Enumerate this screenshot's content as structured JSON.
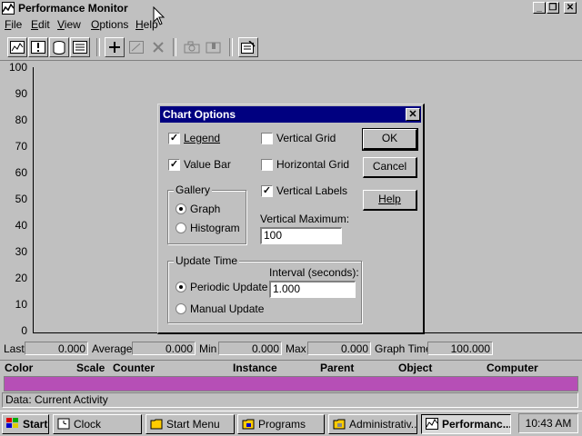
{
  "window": {
    "title": "Performance Monitor",
    "caption_buttons": [
      "minimize",
      "restore",
      "close"
    ]
  },
  "menu": [
    {
      "label": "File",
      "underline": "F"
    },
    {
      "label": "Edit",
      "underline": "E"
    },
    {
      "label": "View",
      "underline": "V"
    },
    {
      "label": "Options",
      "underline": "O"
    },
    {
      "label": "Help",
      "underline": "H"
    }
  ],
  "toolbar": {
    "icons": [
      "chart-view-icon",
      "alert-view-icon",
      "log-view-icon",
      "report-view-icon",
      "add-counter-icon",
      "edit-counter-icon",
      "delete-counter-icon",
      "update-now-icon",
      "bookmark-icon",
      "options-icon"
    ]
  },
  "graph": {
    "y_ticks": [
      "100",
      "90",
      "80",
      "70",
      "60",
      "50",
      "40",
      "30",
      "20",
      "10",
      "0"
    ]
  },
  "value_bar": {
    "last_label": "Last",
    "last_value": "0.000",
    "average_label": "Average",
    "average_value": "0.000",
    "min_label": "Min",
    "min_value": "0.000",
    "max_label": "Max",
    "max_value": "0.000",
    "graph_time_label": "Graph Time",
    "graph_time_value": "100.000"
  },
  "legend_columns": [
    "Color",
    "Scale",
    "Counter",
    "Instance",
    "Parent",
    "Object",
    "Computer"
  ],
  "legend_row_color": "#b64fb6",
  "status": "Data: Current Activity",
  "dialog": {
    "title": "Chart Options",
    "legend_label": "Legend",
    "legend_checked": true,
    "value_bar_label": "Value Bar",
    "value_bar_checked": true,
    "vertical_grid_label": "Vertical Grid",
    "vertical_grid_checked": false,
    "horizontal_grid_label": "Horizontal Grid",
    "horizontal_grid_checked": false,
    "vertical_labels_label": "Vertical Labels",
    "vertical_labels_checked": true,
    "gallery_title": "Gallery",
    "graph_label": "Graph",
    "histogram_label": "Histogram",
    "gallery_selected": "Graph",
    "vertical_maximum_label": "Vertical Maximum:",
    "vertical_maximum_value": "100",
    "update_time_title": "Update Time",
    "interval_label": "Interval (seconds):",
    "interval_value": "1.000",
    "periodic_label": "Periodic Update",
    "manual_label": "Manual Update",
    "update_selected": "Periodic Update",
    "ok_label": "OK",
    "cancel_label": "Cancel",
    "help_label": "Help"
  },
  "taskbar": {
    "start_label": "Start",
    "tasks": [
      {
        "label": "Clock",
        "icon": "clock-icon",
        "active": false
      },
      {
        "label": "Start Menu",
        "icon": "folder-icon",
        "active": false
      },
      {
        "label": "Programs",
        "icon": "programs-icon",
        "active": false
      },
      {
        "label": "Administrativ...",
        "icon": "admin-tools-icon",
        "active": false
      },
      {
        "label": "Performanc...",
        "icon": "perfmon-icon",
        "active": true
      }
    ],
    "clock": "10:43 AM"
  }
}
